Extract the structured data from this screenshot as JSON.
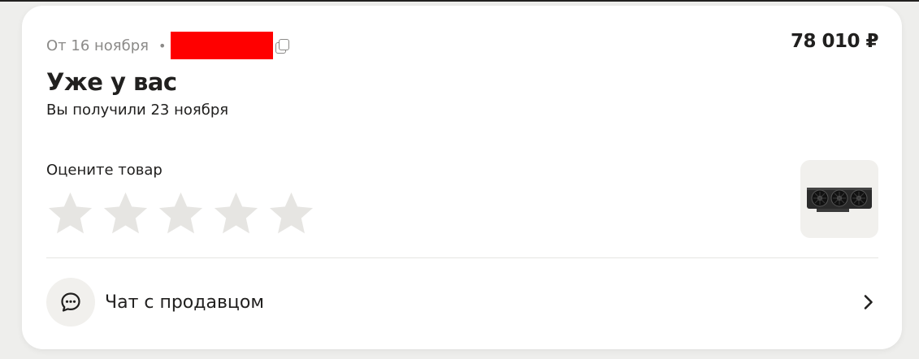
{
  "order": {
    "date_text": "От 16 ноября",
    "separator": "•",
    "price": "78 010 ₽",
    "status_title": "Уже у вас",
    "status_subtitle": "Вы получили 23 ноября"
  },
  "rating": {
    "label": "Оцените товар",
    "stars_total": 5,
    "stars_selected": 0,
    "star_color": "#e6e5e2"
  },
  "product": {
    "thumbnail_icon": "graphics-card-image"
  },
  "chat": {
    "label": "Чат с продавцом",
    "icon": "chat-bubble-icon"
  },
  "colors": {
    "background": "#eeeeec",
    "card": "#ffffff",
    "muted_text": "#8b8a88",
    "primary_text": "#21201f",
    "redaction": "#ff0000"
  }
}
